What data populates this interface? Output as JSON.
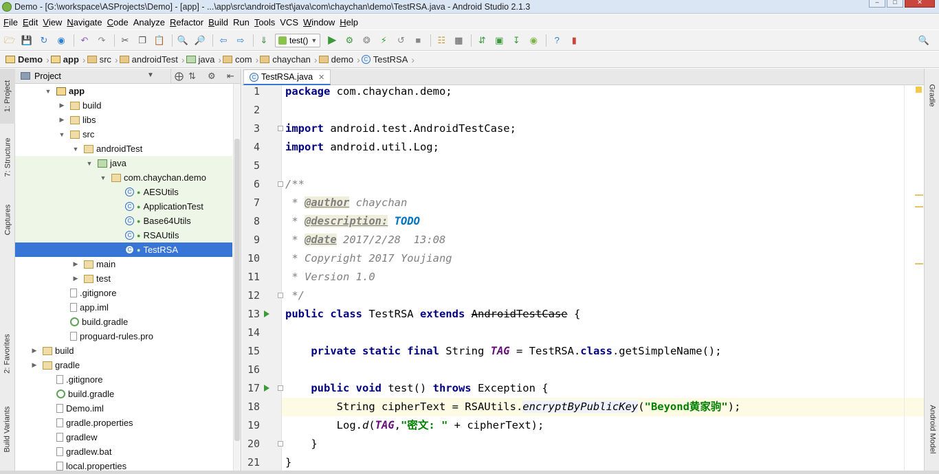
{
  "window": {
    "title": "Demo - [G:\\workspace\\ASProjects\\Demo] - [app] - ...\\app\\src\\androidTest\\java\\com\\chaychan\\demo\\TestRSA.java - Android Studio 2.1.3"
  },
  "menu": [
    {
      "key": "F",
      "rest": "ile"
    },
    {
      "key": "E",
      "rest": "dit"
    },
    {
      "key": "V",
      "rest": "iew"
    },
    {
      "key": "N",
      "rest": "avigate"
    },
    {
      "key": "C",
      "rest": "ode"
    },
    {
      "key": "",
      "rest": "Analyze"
    },
    {
      "key": "R",
      "rest": "efactor"
    },
    {
      "key": "B",
      "rest": "uild"
    },
    {
      "key": "",
      "rest": "Run"
    },
    {
      "key": "T",
      "rest": "ools"
    },
    {
      "key": "",
      "rest": "VCS"
    },
    {
      "key": "W",
      "rest": "indow"
    },
    {
      "key": "H",
      "rest": "elp"
    }
  ],
  "toolbar": {
    "run_config": "test()"
  },
  "breadcrumbs": [
    "Demo",
    "app",
    "src",
    "androidTest",
    "java",
    "com",
    "chaychan",
    "demo",
    "TestRSA"
  ],
  "project_panel": {
    "title": "Project",
    "tree": [
      {
        "label": "app",
        "depth": 1,
        "twisty": "open",
        "icon": "module",
        "bold": true
      },
      {
        "label": "build",
        "depth": 2,
        "twisty": "closed",
        "icon": "folder"
      },
      {
        "label": "libs",
        "depth": 2,
        "twisty": "closed",
        "icon": "folder"
      },
      {
        "label": "src",
        "depth": 2,
        "twisty": "open",
        "icon": "folder"
      },
      {
        "label": "androidTest",
        "depth": 3,
        "twisty": "open",
        "icon": "folder"
      },
      {
        "label": "java",
        "depth": 4,
        "twisty": "open",
        "icon": "source-folder",
        "tint": true
      },
      {
        "label": "com.chaychan.demo",
        "depth": 5,
        "twisty": "open",
        "icon": "package",
        "tint": true
      },
      {
        "label": "AESUtils",
        "depth": 6,
        "icon": "class",
        "tint": true
      },
      {
        "label": "ApplicationTest",
        "depth": 6,
        "icon": "class",
        "tint": true
      },
      {
        "label": "Base64Utils",
        "depth": 6,
        "icon": "class",
        "tint": true
      },
      {
        "label": "RSAUtils",
        "depth": 6,
        "icon": "class",
        "tint": true
      },
      {
        "label": "TestRSA",
        "depth": 6,
        "icon": "class",
        "selected": true
      },
      {
        "label": "main",
        "depth": 3,
        "twisty": "closed",
        "icon": "folder"
      },
      {
        "label": "test",
        "depth": 3,
        "twisty": "closed",
        "icon": "folder"
      },
      {
        "label": ".gitignore",
        "depth": 2,
        "icon": "file"
      },
      {
        "label": "app.iml",
        "depth": 2,
        "icon": "file"
      },
      {
        "label": "build.gradle",
        "depth": 2,
        "icon": "gradle"
      },
      {
        "label": "proguard-rules.pro",
        "depth": 2,
        "icon": "file"
      },
      {
        "label": "build",
        "depth": 0,
        "twisty": "closed",
        "icon": "folder"
      },
      {
        "label": "gradle",
        "depth": 0,
        "twisty": "closed",
        "icon": "folder"
      },
      {
        "label": ".gitignore",
        "depth": 1,
        "icon": "file"
      },
      {
        "label": "build.gradle",
        "depth": 1,
        "icon": "gradle"
      },
      {
        "label": "Demo.iml",
        "depth": 1,
        "icon": "file"
      },
      {
        "label": "gradle.properties",
        "depth": 1,
        "icon": "file"
      },
      {
        "label": "gradlew",
        "depth": 1,
        "icon": "file"
      },
      {
        "label": "gradlew.bat",
        "depth": 1,
        "icon": "file"
      },
      {
        "label": "local.properties",
        "depth": 1,
        "icon": "file"
      }
    ]
  },
  "left_tool_tabs": [
    "1: Project",
    "7: Structure",
    "Captures",
    "2: Favorites",
    "Build Variants"
  ],
  "right_tool_tabs": [
    "Gradle",
    "Android Model"
  ],
  "editor": {
    "tab_label": "TestRSA.java",
    "line_numbers": [
      "1",
      "2",
      "3",
      "4",
      "5",
      "6",
      "7",
      "8",
      "9",
      "10",
      "11",
      "12",
      "13",
      "14",
      "15",
      "16",
      "17",
      "18",
      "19",
      "20",
      "21"
    ],
    "code": {
      "l1_kw": "package",
      "l1_rest": " com.chaychan.demo;",
      "l3_kw": "import",
      "l3_rest": " android.test.AndroidTestCase;",
      "l4_kw": "import",
      "l4_rest": " android.util.Log;",
      "l6": "/**",
      "l7_pre": " * ",
      "l7_tag": "@author",
      "l7_rest": " chaychan",
      "l8_pre": " * ",
      "l8_tag": "@description:",
      "l8_todo": " TODO",
      "l9_pre": " * ",
      "l9_tag": "@date",
      "l9_rest": " 2017/2/28  13:08",
      "l10": " * Copyright 2017 Youjiang",
      "l11": " * Version 1.0",
      "l12": " */",
      "l13_kw1": "public class",
      "l13_mid": " TestRSA ",
      "l13_kw2": "extends",
      "l13_sp": " ",
      "l13_deprecated": "AndroidTestCase",
      "l13_end": " {",
      "l15_indent": "    ",
      "l15_kw": "private static final",
      "l15_type": " String ",
      "l15_field": "TAG",
      "l15_mid": " = TestRSA.",
      "l15_kw2": "class",
      "l15_end": ".getSimpleName();",
      "l17_indent": "    ",
      "l17_kw": "public void",
      "l17_mid": " test() ",
      "l17_kw2": "throws",
      "l17_end": " Exception {",
      "l18_pre": "        String cipherText = RSAUtils.",
      "l18_method": "encryptByPublicKey",
      "l18_open": "(",
      "l18_str": "\"Beyond黄家驹\"",
      "l18_end": ");",
      "l19_pre": "        Log.",
      "l19_method": "d",
      "l19_open": "(",
      "l19_field": "TAG",
      "l19_comma": ",",
      "l19_str": "\"密文: \"",
      "l19_end": " + cipherText);",
      "l20": "    }",
      "l21": "}"
    }
  }
}
